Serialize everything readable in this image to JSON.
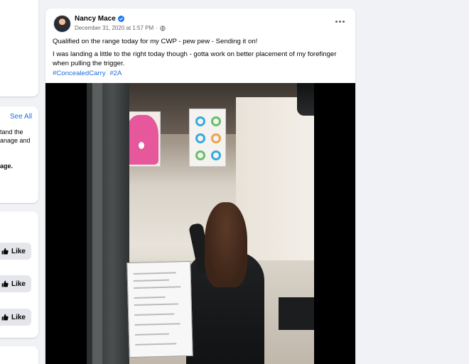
{
  "sidebar": {
    "see_all": "See All",
    "text_line_1": "tand the",
    "text_line_2": "anage and",
    "text_line_3": "age.",
    "like_buttons": [
      "Like",
      "Like",
      "Like"
    ]
  },
  "post": {
    "author": "Nancy Mace",
    "timestamp": "December 31, 2020 at 1:57 PM",
    "timestamp_separator": "·",
    "privacy_icon": "globe-icon",
    "verified_icon": "verified-badge-icon",
    "more_icon": "more-horizontal-icon",
    "line_1": "Qualified on the range today for my CWP - pew pew - Sending it on!",
    "line_2": "I was landing a little to the right today though - gotta work on better placement of my forefinger when pulling the trigger.",
    "hashtags": [
      "#ConcealedCarry",
      "#2A"
    ]
  },
  "colors": {
    "background": "#f0f2f5",
    "card": "#ffffff",
    "link": "#216fdb",
    "verified": "#1877f2",
    "muted": "#65676b"
  }
}
